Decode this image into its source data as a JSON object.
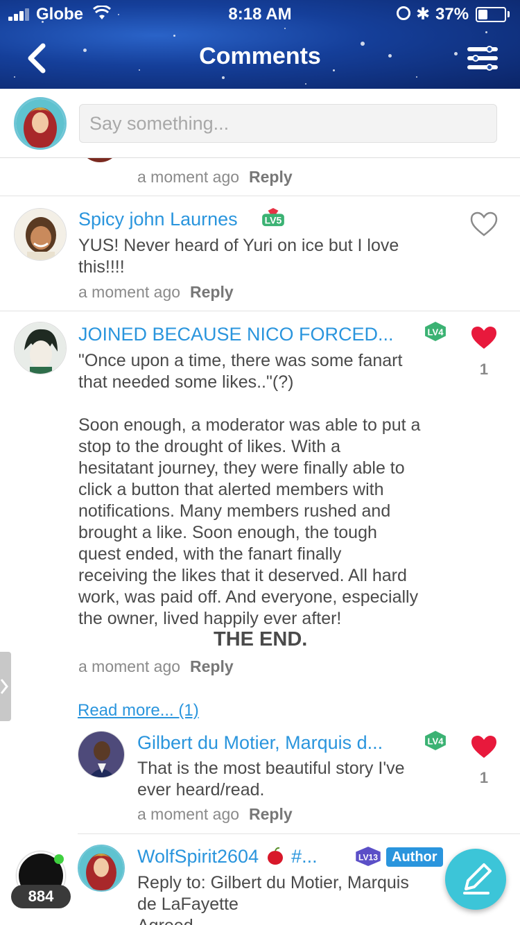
{
  "status_bar": {
    "carrier": "Globe",
    "time": "8:18 AM",
    "battery": "37%",
    "battery_level": 0.37
  },
  "header": {
    "title": "Comments"
  },
  "composer": {
    "placeholder": "Say something..."
  },
  "comments": [
    {
      "meta_time": "a moment ago",
      "reply": "Reply"
    },
    {
      "name": "Spicy john Laurnes",
      "level": "LV5",
      "text": "YUS! Never heard of Yuri on ice but I love\nthis!!!!",
      "time": "a moment ago",
      "reply": "Reply"
    },
    {
      "name": "JOINED BECAUSE NICO FORCED...",
      "level": "LV4",
      "text": "\"Once upon a time, there was some fanart\nthat needed some likes..\"(?)\n\nSoon enough, a moderator was able to put a\nstop to the drought of likes. With a\nhesitatant journey, they were finally able to\nclick a button that alerted members with\nnotifications. Many members rushed and\nbrought a like. Soon enough, the tough\nquest ended, with the fanart finally\nreceiving the likes that it deserved. All hard\nwork, was paid off. And everyone, especially\nthe owner, lived happily ever after!",
      "ending": "THE END.",
      "likes": "1",
      "time": "a moment ago",
      "reply": "Reply",
      "read_more": "Read more... (1)"
    },
    {
      "name": "Gilbert du Motier, Marquis d...",
      "level": "LV4",
      "text": "That is the most beautiful story I've\never heard/read.",
      "likes": "1",
      "time": "a moment ago",
      "reply": "Reply"
    },
    {
      "name": "WolfSpirit2604",
      "name_suffix": "#...",
      "level": "LV13",
      "role": "Author",
      "text": "Reply to: Gilbert du Motier, Marquis\nde LaFayette\nAgreed"
    }
  ],
  "online_count": "884",
  "colors": {
    "accent": "#2a95dd",
    "heart": "#e8193c",
    "fab": "#3cc5d8"
  }
}
